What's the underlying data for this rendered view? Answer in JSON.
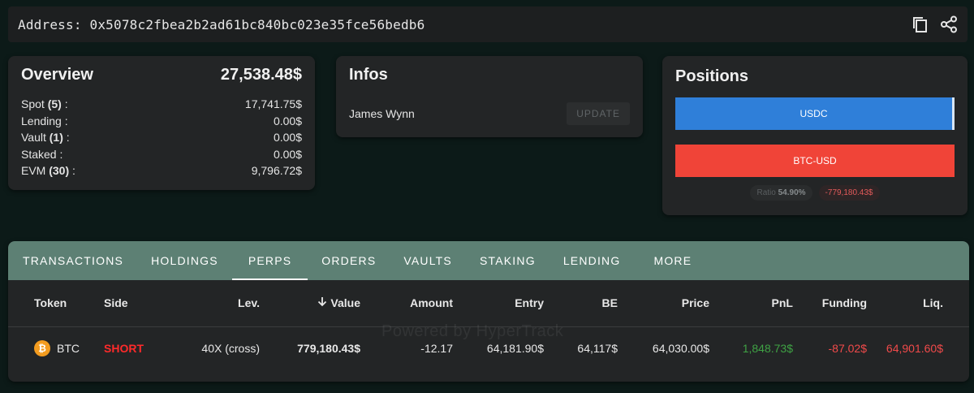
{
  "address": {
    "text": "Address: 0x5078c2fbea2b2ad61bc840bc023e35fce56bedb6"
  },
  "overview": {
    "title": "Overview",
    "total": "27,538.48$",
    "rows": [
      {
        "label": "Spot",
        "count": "(5)",
        "suffix": " :",
        "value": "17,741.75$"
      },
      {
        "label": "Lending :",
        "count": "",
        "suffix": "",
        "value": "0.00$"
      },
      {
        "label": "Vault",
        "count": "(1)",
        "suffix": " :",
        "value": "0.00$"
      },
      {
        "label": "Staked :",
        "count": "",
        "suffix": "",
        "value": "0.00$"
      },
      {
        "label": "EVM",
        "count": "(30)",
        "suffix": " :",
        "value": "9,796.72$"
      }
    ]
  },
  "infos": {
    "title": "Infos",
    "name": "James Wynn",
    "update_label": "UPDATE"
  },
  "positions": {
    "title": "Positions",
    "bars": [
      {
        "label": "USDC",
        "color": "#2f7fd9"
      },
      {
        "label": "BTC-USD",
        "color": "#f04438"
      }
    ],
    "ratio_label": "Ratio",
    "ratio_value": "54.90%",
    "net_value": "-779,180.43$"
  },
  "tabs": [
    {
      "label": "TRANSACTIONS",
      "active": false
    },
    {
      "label": "HOLDINGS",
      "active": false
    },
    {
      "label": "PERPS",
      "active": true
    },
    {
      "label": "ORDERS",
      "active": false
    },
    {
      "label": "VAULTS",
      "active": false
    },
    {
      "label": "STAKING",
      "active": false
    },
    {
      "label": "LENDING",
      "active": false
    },
    {
      "label": "MORE",
      "active": false
    }
  ],
  "table": {
    "headers": [
      "Token",
      "Side",
      "Lev.",
      "Value",
      "Amount",
      "Entry",
      "BE",
      "Price",
      "PnL",
      "Funding",
      "Liq."
    ],
    "rows": [
      {
        "token": "BTC",
        "token_icon": "bitcoin-icon",
        "side": "SHORT",
        "lev": "40X (cross)",
        "value": "779,180.43$",
        "amount": "-12.17",
        "entry": "64,181.90$",
        "be": "64,117$",
        "price": "64,030.00$",
        "pnl": "1,848.73$",
        "funding": "-87.02$",
        "liq": "64,901.60$"
      }
    ]
  },
  "watermark": "Powered by HyperTrack",
  "colors": {
    "background": "#0c1a18",
    "card": "#232526",
    "tab_bar": "#5d8074",
    "positive": "#3fa244",
    "negative": "#f04a4a"
  }
}
